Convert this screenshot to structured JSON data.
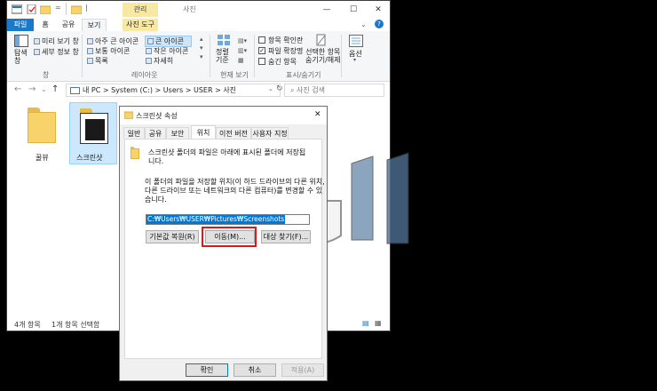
{
  "explorer": {
    "titlebar": {
      "context_header": "관리",
      "window_title": "사진",
      "minimize": "—",
      "maximize": "☐",
      "close": "✕",
      "qat_arrow": "="
    },
    "tabs": {
      "file": "파일",
      "home": "홈",
      "share": "공유",
      "view": "보기",
      "picture_tools": "사진 도구"
    },
    "help_glyph": "?",
    "ribbon": {
      "nav_pane": "탐색\n창",
      "preview_pane": "미리 보기 창",
      "details_pane": "세부 정보 창",
      "pane_group": "창",
      "layout": {
        "extra_large": "아주 큰 아이콘",
        "large": "큰 아이콘",
        "medium": "보통 아이콘",
        "small": "작은 아이콘",
        "list": "목록",
        "details": "자세히",
        "group": "레이아웃"
      },
      "sort": "정렬\n기준",
      "current_view_group": "현재 보기",
      "show_hide": {
        "item_checkbox": "항목 확인란",
        "file_extension": "파일 확장명",
        "hidden_items": "숨긴 항목",
        "hide_selected": "선택한 항목\n숨기기/해제",
        "group": "표시/숨기기"
      },
      "options": "옵션"
    },
    "address": {
      "back": "←",
      "forward": "→",
      "dropdown": "⌄",
      "up": "↑",
      "path": "내 PC  >  System (C:)  >  Users  >  USER  >  사진",
      "search_placeholder": "사진 검색"
    },
    "items": [
      {
        "label": "꿀뷰"
      },
      {
        "label": "스크린샷"
      }
    ],
    "status": {
      "count": "4개 항목",
      "selected": "1개 항목 선택함"
    }
  },
  "dialog": {
    "title": "스크린샷 속성",
    "close": "✕",
    "tabs": [
      "일반",
      "공유",
      "보안",
      "위치",
      "이전 버전",
      "사용자 지정"
    ],
    "active_tab": "위치",
    "description_1": "스크린샷 폴더의 파일은 아래에 표시된 폴더에 저장됩\n니다.",
    "description_2": "이 폴더의 파일을 저장할 위치(이 하드 드라이브의 다른 위치,\n다른 드라이브 또는 네트워크의 다른 컴퓨터)를 변경할 수 있\n습니다.",
    "path_value": "C:₩Users₩USER₩Pictures₩Screenshots",
    "buttons": {
      "restore_default": "기본값 복원(R)",
      "move": "이동(M)...",
      "find_target": "대상 찾기(F)...",
      "ok": "확인",
      "cancel": "취소",
      "apply": "적용(A)"
    }
  },
  "colors": {
    "file_tab": "#1979ca",
    "context_tab": "#f7e8a4",
    "highlight_box": "#e0161b",
    "selection": "#0078d7"
  }
}
